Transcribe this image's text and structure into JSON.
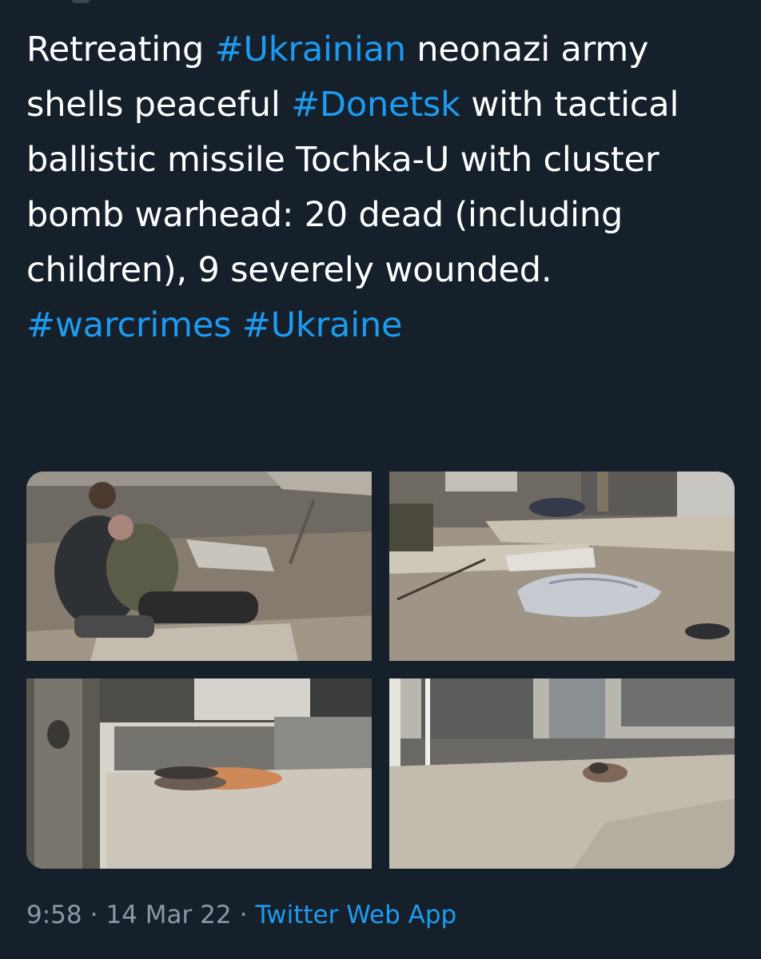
{
  "tweet": {
    "text_segments": [
      {
        "text": "Retreating ",
        "type": "text"
      },
      {
        "text": "#Ukrainian",
        "type": "hashtag"
      },
      {
        "text": " neonazi army shells peaceful ",
        "type": "text"
      },
      {
        "text": "#Donetsk",
        "type": "hashtag"
      },
      {
        "text": " with tactical ballistic missile Tochka-U with cluster bomb warhead: 20 dead (including children), 9 severely wounded. ",
        "type": "text"
      },
      {
        "text": "#warcrimes",
        "type": "hashtag"
      },
      {
        "text": " ",
        "type": "text"
      },
      {
        "text": "#Ukraine",
        "type": "hashtag"
      }
    ],
    "media": {
      "count": 4
    },
    "meta": {
      "time": "9:58",
      "separator_1": "·",
      "date": "14 Mar 22",
      "separator_2": "·",
      "source": "Twitter Web App"
    }
  },
  "colors": {
    "background": "#15202b",
    "text": "#ffffff",
    "link": "#1d9bf0",
    "muted": "#8b98a5"
  }
}
